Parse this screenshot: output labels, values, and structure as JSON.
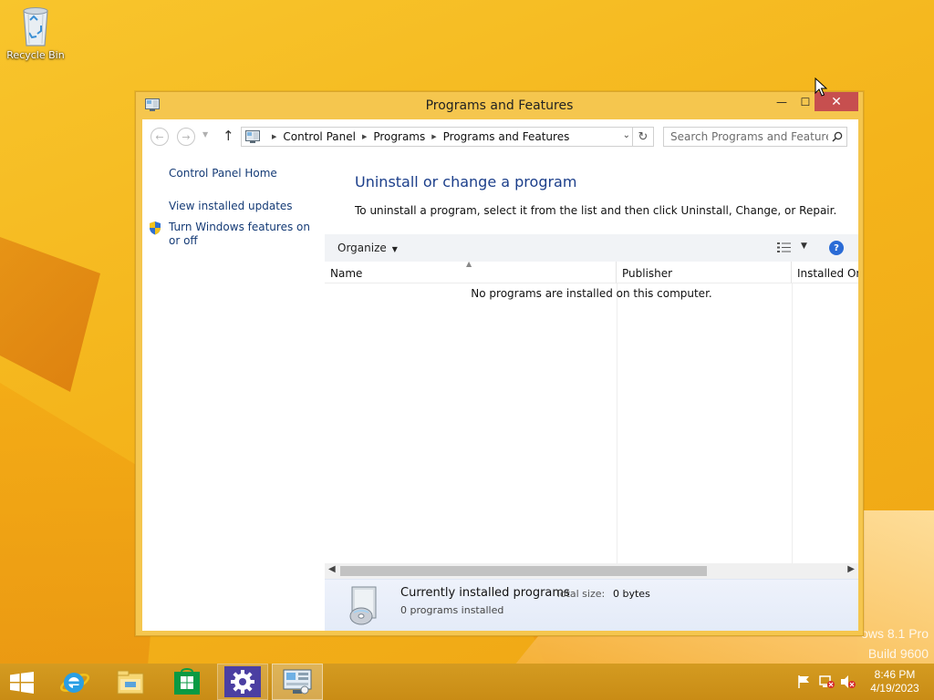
{
  "desktop": {
    "recycle_bin_label": "Recycle Bin",
    "watermark": {
      "line1": "ows 8.1 Pro",
      "line2": "Build 9600"
    }
  },
  "window": {
    "title": "Programs and Features",
    "controls": {
      "minimize": "—",
      "maximize": "☐",
      "close": "✕"
    },
    "accent_color": "#f5c64e",
    "close_color": "#c74f4f"
  },
  "address": {
    "breadcrumb": [
      "Control Panel",
      "Programs",
      "Programs and Features"
    ],
    "search_placeholder": "Search Programs and Features"
  },
  "left_pane": {
    "links": [
      "Control Panel Home",
      "View installed updates",
      "Turn Windows features on or off"
    ]
  },
  "main": {
    "heading": "Uninstall or change a program",
    "description": "To uninstall a program, select it from the list and then click Uninstall, Change, or Repair.",
    "toolbar": {
      "organize": "Organize",
      "help": "?"
    },
    "columns": [
      "Name",
      "Publisher",
      "Installed On"
    ],
    "empty_message": "No programs are installed on this computer.",
    "heading_color": "#1b3e8a",
    "link_color": "#153b76"
  },
  "details": {
    "title": "Currently installed programs",
    "total_size_label": "Total size:",
    "total_size": "0 bytes",
    "count": "0 programs installed"
  },
  "taskbar": {
    "apps": [
      "start-icon",
      "internet-explorer-icon",
      "file-explorer-icon",
      "store-icon",
      "settings-icon",
      "control-panel-icon"
    ],
    "tray_icons": [
      "action-center-flag-icon",
      "network-icon",
      "volume-muted-icon"
    ],
    "time": "8:46 PM",
    "date": "4/19/2023",
    "color": "#d49b21"
  }
}
